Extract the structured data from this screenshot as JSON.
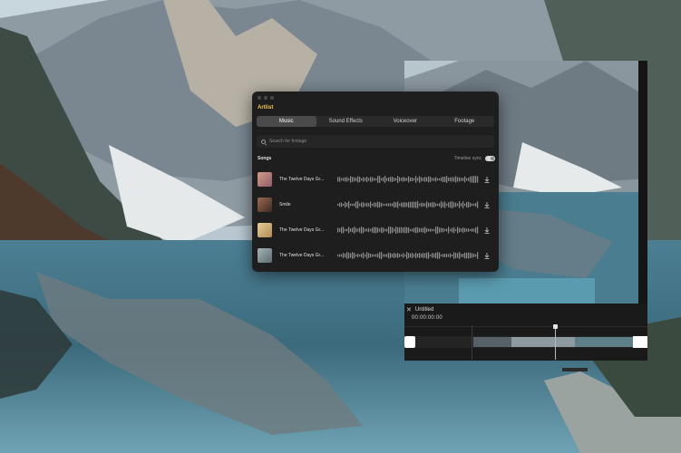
{
  "popup": {
    "brand": "Artlist",
    "tabs": [
      {
        "label": "Music",
        "active": true
      },
      {
        "label": "Sound Effects",
        "active": false
      },
      {
        "label": "Voiceover",
        "active": false
      },
      {
        "label": "Footage",
        "active": false
      }
    ],
    "search": {
      "placeholder": "Search for footage",
      "value": ""
    },
    "section_title": "Songs",
    "timeline_sync_label": "Timeline sync",
    "timeline_sync_on": true,
    "songs": [
      {
        "title": "The Twelve Days Gr...",
        "thumb_color": "#b77a7a"
      },
      {
        "title": "Smile",
        "thumb_color": "#6e4a3a"
      },
      {
        "title": "The Twelve Days Gr...",
        "thumb_color": "#c9a46a"
      },
      {
        "title": "The Twelve Days Gr...",
        "thumb_color": "#7f8c8f"
      }
    ],
    "accent_color": "#f2c84b"
  },
  "editor": {
    "project_name": "Untitled",
    "timecode": "00:00:00:00"
  },
  "icons": [
    "close-icon",
    "search-icon",
    "download-icon"
  ]
}
